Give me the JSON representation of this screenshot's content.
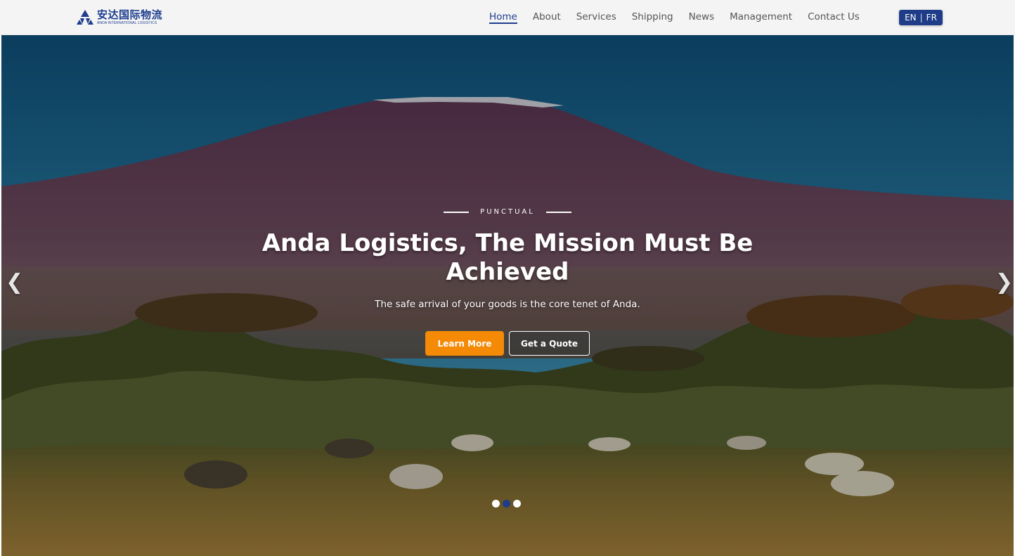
{
  "brand": {
    "name_cn": "安达国际物流",
    "name_en": "ANDA INTERNATIONAL LOGISTICS",
    "color": "#1e3d8f"
  },
  "nav": {
    "items": [
      {
        "label": "Home",
        "active": true
      },
      {
        "label": "About"
      },
      {
        "label": "Services"
      },
      {
        "label": "Shipping"
      },
      {
        "label": "News"
      },
      {
        "label": "Management"
      },
      {
        "label": "Contact Us"
      }
    ]
  },
  "language": {
    "en": "EN",
    "separator": "|",
    "fr": "FR"
  },
  "hero": {
    "kicker": "PUNCTUAL",
    "title": "Anda Logistics, The Mission Must Be Achieved",
    "subtitle": "The safe arrival of your goods is the core tenet of Anda.",
    "primary_button": "Learn More",
    "secondary_button": "Get a Quote",
    "prev_icon": "chevron-left-icon",
    "next_icon": "chevron-right-icon",
    "slides_total": 3,
    "active_slide": 2,
    "accent_color": "#f58a07"
  }
}
